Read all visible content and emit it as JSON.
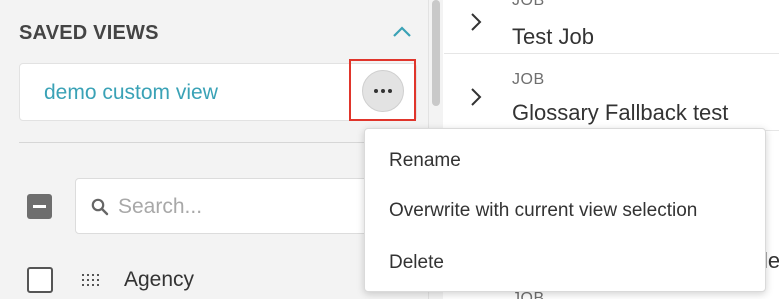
{
  "sidebar": {
    "saved_views_title": "SAVED VIEWS",
    "views": [
      {
        "label": "demo custom view"
      }
    ],
    "search": {
      "placeholder": "Search...",
      "value": ""
    },
    "filters": [
      {
        "label": "Agency"
      }
    ]
  },
  "jobs": [
    {
      "type": "JOB",
      "title": "Test Job"
    },
    {
      "type": "JOB",
      "title": "Glossary Fallback test"
    },
    {
      "type": "JOB",
      "title": "le"
    }
  ],
  "dropdown_menu": {
    "items": [
      {
        "label": "Rename"
      },
      {
        "label": "Overwrite with current view selection"
      },
      {
        "label": "Delete"
      }
    ]
  },
  "colors": {
    "accent": "#3aa2b6",
    "highlight": "#e0352b",
    "sidebar_bg": "#f3f3f3"
  },
  "icons": [
    "chevron-up-icon",
    "more-horizontal-icon",
    "search-icon",
    "drag-handle-icon",
    "chevron-right-icon"
  ]
}
